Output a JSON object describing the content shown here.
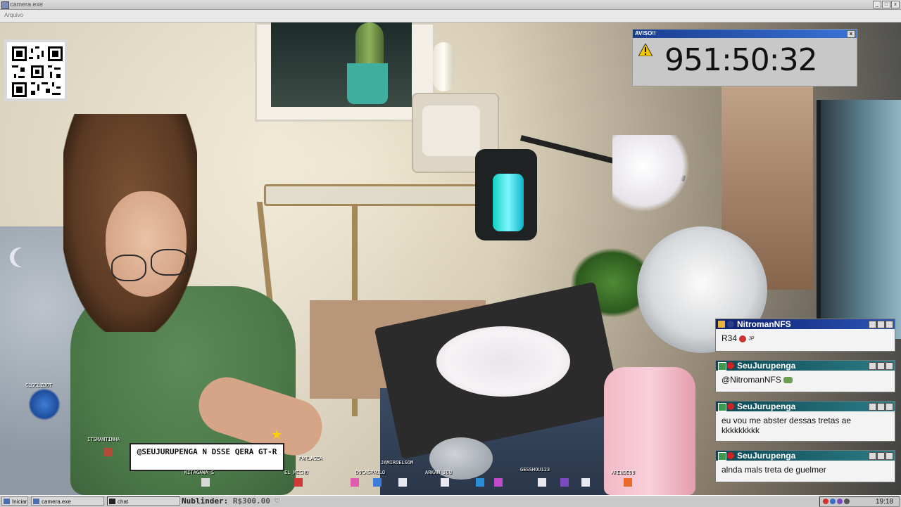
{
  "window": {
    "title": "camera.exe",
    "menu_item": "Arquivo",
    "btn_min": "_",
    "btn_max": "□",
    "btn_close": "x"
  },
  "alert": {
    "title": "AVISO!!",
    "timer": "951:50:32",
    "close": "x"
  },
  "chat_messages": [
    {
      "user": "NitromanNFS",
      "text": "R34",
      "emote": "JP"
    },
    {
      "user": "SeuJurupenga",
      "text": "@NitromanNFS"
    },
    {
      "user": "SeuJurupenga",
      "text": "eu vou me abster dessas tretas ae kkkkkkkkk"
    },
    {
      "user": "SeuJurupenga",
      "text": "alnda mals treta de guelmer"
    }
  ],
  "stream_overlay": {
    "speech_bubble": "@SEUJURUPENGA N DSSE QERA GT-R",
    "nicknames": [
      "CLGCLZBOT",
      "ITSMANTINHA",
      "PARLASEA",
      "EL_MECHO",
      "DOCASPAULO",
      "JAMIROELSOM",
      "ARKAN_JOU",
      "GESSHOU123",
      "ARENDEOU",
      "KITAGAWA_S"
    ]
  },
  "taskbar": {
    "start": "Iniciar",
    "camera_task": "camera.exe",
    "chat_task": "chat",
    "ticker_label": "Nublinder:",
    "ticker_amount": "R$300.00",
    "ticker_heart": "♡",
    "clock": "19:18"
  },
  "colors": {
    "alert_titlebar": "#1a3d8f",
    "chat_title_blue": "#0c1f6e",
    "chat_title_teal": "#0d4753",
    "timer_text": "#111111"
  }
}
